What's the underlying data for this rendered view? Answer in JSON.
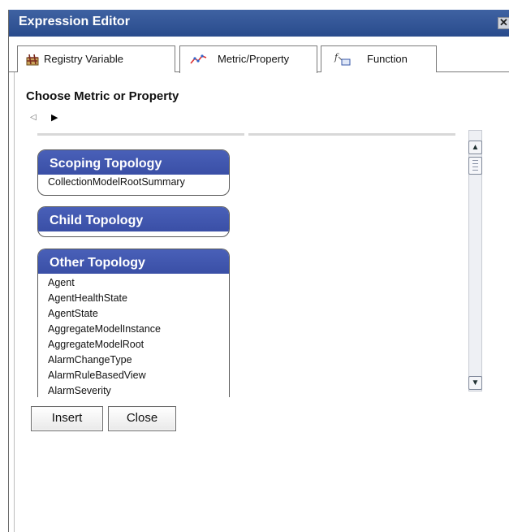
{
  "window": {
    "title": "Expression Editor",
    "close_glyph": "✕"
  },
  "tabs": [
    {
      "label": "Registry Variable",
      "icon": "registry-icon"
    },
    {
      "label": "Metric/Property",
      "icon": "metric-chart-icon"
    },
    {
      "label": "Function",
      "icon": "function-icon"
    }
  ],
  "main": {
    "heading": "Choose Metric or Property",
    "nav_back": "◁",
    "nav_forward": "▶"
  },
  "groups": {
    "scoping": {
      "title": "Scoping Topology",
      "items": [
        "CollectionModelRootSummary"
      ]
    },
    "child": {
      "title": "Child Topology",
      "items": []
    },
    "other": {
      "title": "Other Topology",
      "items": [
        "Agent",
        "AgentHealthState",
        "AgentState",
        "AggregateModelInstance",
        "AggregateModelRoot",
        "AlarmChangeType",
        "AlarmRuleBasedView",
        "AlarmSeverity"
      ]
    }
  },
  "scrollbar": {
    "up": "▲",
    "down": "▼"
  },
  "buttons": {
    "insert": "Insert",
    "close": "Close"
  }
}
